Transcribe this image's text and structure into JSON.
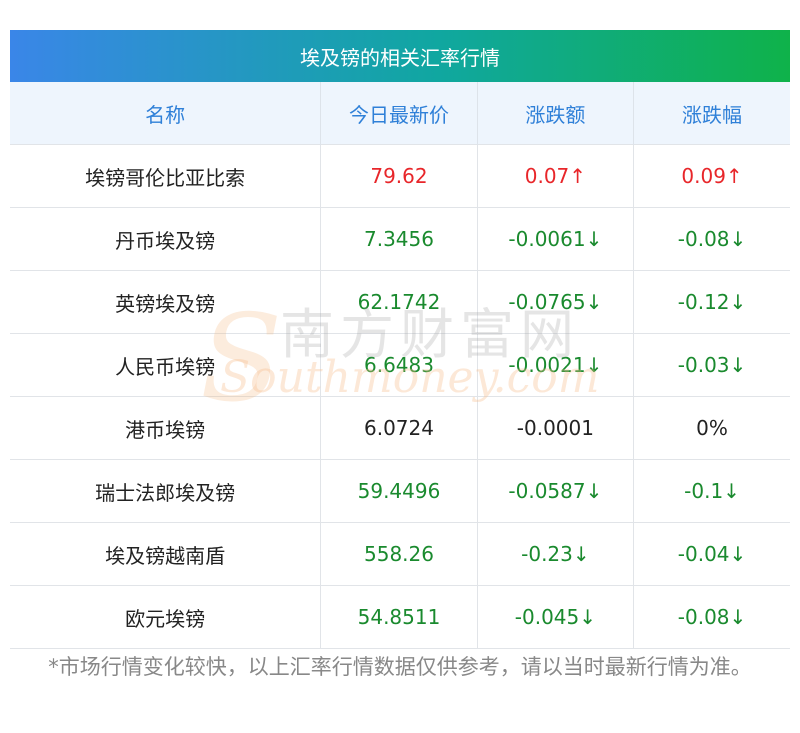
{
  "title": "埃及镑的相关汇率行情",
  "columns": [
    "名称",
    "今日最新价",
    "涨跌额",
    "涨跌幅"
  ],
  "rows": [
    {
      "name": "埃镑哥伦比亚比索",
      "price": "79.62",
      "change": "0.07↑",
      "pct": "0.09↑",
      "trend": "up"
    },
    {
      "name": "丹币埃及镑",
      "price": "7.3456",
      "change": "-0.0061↓",
      "pct": "-0.08↓",
      "trend": "down"
    },
    {
      "name": "英镑埃及镑",
      "price": "62.1742",
      "change": "-0.0765↓",
      "pct": "-0.12↓",
      "trend": "down"
    },
    {
      "name": "人民币埃镑",
      "price": "6.6483",
      "change": "-0.0021↓",
      "pct": "-0.03↓",
      "trend": "down"
    },
    {
      "name": "港币埃镑",
      "price": "6.0724",
      "change": "-0.0001",
      "pct": "0%",
      "trend": "flat"
    },
    {
      "name": "瑞士法郎埃及镑",
      "price": "59.4496",
      "change": "-0.0587↓",
      "pct": "-0.1↓",
      "trend": "down"
    },
    {
      "name": "埃及镑越南盾",
      "price": "558.26",
      "change": "-0.23↓",
      "pct": "-0.04↓",
      "trend": "down"
    },
    {
      "name": "欧元埃镑",
      "price": "54.8511",
      "change": "-0.045↓",
      "pct": "-0.08↓",
      "trend": "down"
    }
  ],
  "watermark": {
    "cn": "南方财富网",
    "en": "Southmoney.com",
    "s": "S"
  },
  "footnote": "*市场行情变化较快，以上汇率行情数据仅供参考，请以当时最新行情为准。",
  "colors": {
    "up": "#e8262a",
    "down": "#1a8a2e",
    "header_text": "#2f80d8",
    "header_bg": "#eef5fd"
  }
}
